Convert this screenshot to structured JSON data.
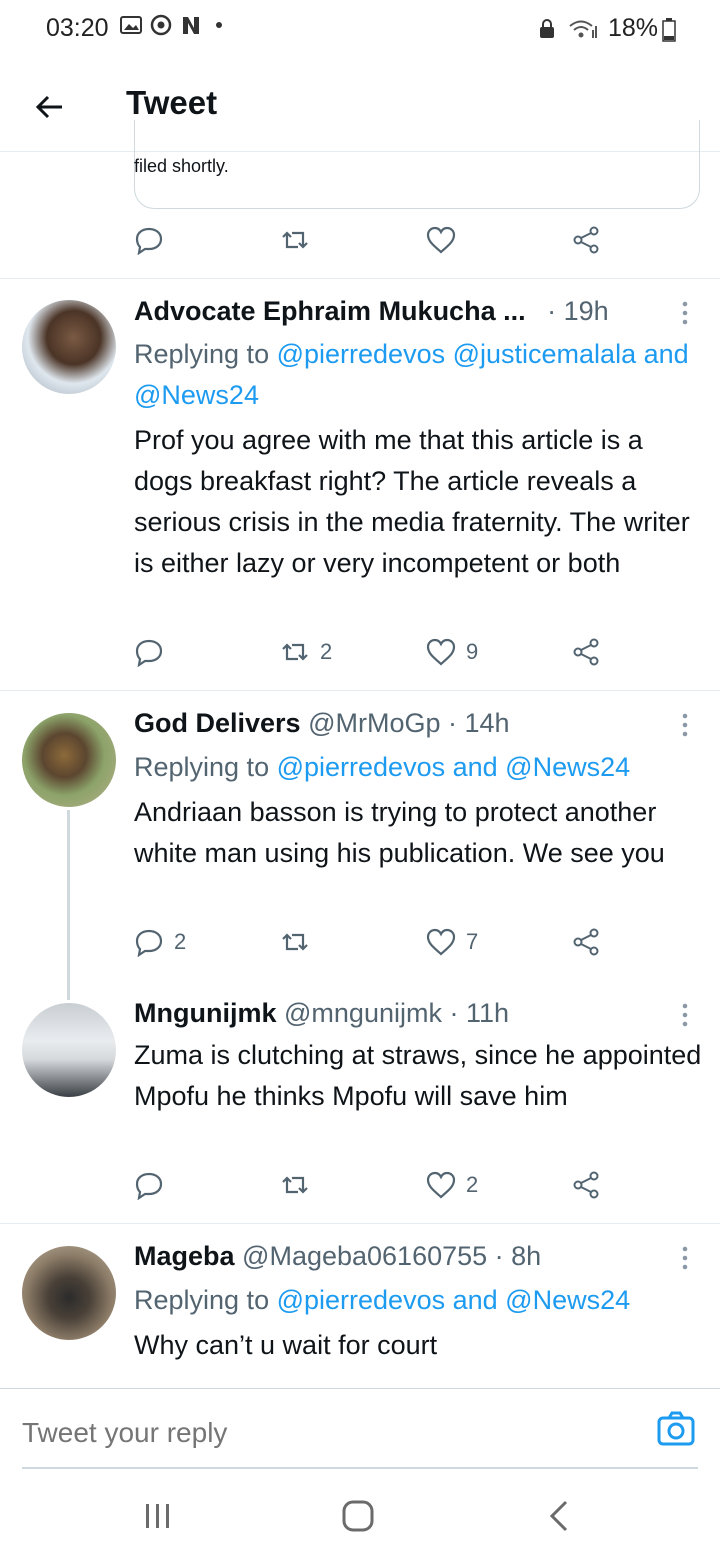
{
  "status_bar": {
    "time": "03:20",
    "battery": "18%"
  },
  "header": {
    "title": "Tweet"
  },
  "quoted_card": {
    "text": "filed shortly."
  },
  "tweets": [
    {
      "name": "Advocate Ephraim Mukucha ...",
      "handle": "",
      "time": "· 19h",
      "replying_prefix": "Replying to ",
      "mention1": "@pierredevos",
      "mention2": "@justicemalala",
      "joiner": "and",
      "mention3": "@News24",
      "body": "Prof you agree with me that this article is a dogs breakfast right? The article reveals a serious crisis in the media fraternity. The writer is either lazy or very incompetent or both",
      "replies": "",
      "retweets": "2",
      "likes": "9"
    },
    {
      "name": "God Delivers",
      "handle": "@MrMoGp",
      "time": "· 14h",
      "replying_prefix": "Replying to ",
      "mention1": "@pierredevos",
      "joiner": " and ",
      "mention2": "@News24",
      "body": "Andriaan basson is trying to protect another white man using his publication. We see you",
      "replies": "2",
      "retweets": "",
      "likes": "7"
    },
    {
      "name": "Mngunijmk",
      "handle": "@mngunijmk",
      "time": "· 11h",
      "body": "Zuma is clutching at straws, since he appointed Mpofu he thinks Mpofu will save him",
      "replies": "",
      "retweets": "",
      "likes": "2"
    },
    {
      "name": "Mageba",
      "handle": "@Mageba06160755",
      "time": "· 8h",
      "replying_prefix": "Replying to ",
      "mention1": "@pierredevos",
      "joiner": " and ",
      "mention2": "@News24",
      "body": "Why can’t u wait for court"
    }
  ],
  "composer": {
    "placeholder": "Tweet your reply"
  },
  "icons": {
    "reply": "reply-icon",
    "retweet": "retweet-icon",
    "like": "heart-icon",
    "share": "share-icon",
    "more": "more-vertical-icon",
    "camera": "camera-icon",
    "back": "arrow-left-icon"
  },
  "colors": {
    "accent": "#1d9bf0",
    "muted": "#536471",
    "text": "#0f1419",
    "divider": "#e6ecf0"
  }
}
